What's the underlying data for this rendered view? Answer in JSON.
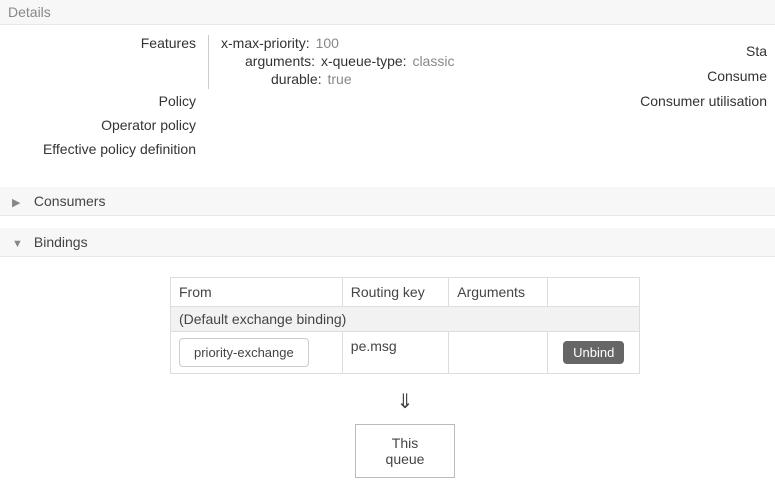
{
  "sections": {
    "details": {
      "title": "Details"
    },
    "consumers": {
      "title": "Consumers"
    },
    "bindings": {
      "title": "Bindings"
    }
  },
  "details": {
    "features_label": "Features",
    "features": {
      "x_max_priority_key": "x-max-priority:",
      "x_max_priority_val": "100",
      "arguments_key": "arguments:",
      "arguments_inner_key": "x-queue-type:",
      "arguments_inner_val": "classic",
      "durable_key": "durable:",
      "durable_val": "true"
    },
    "policy_label": "Policy",
    "operator_policy_label": "Operator policy",
    "effective_policy_label": "Effective policy definition"
  },
  "meta": {
    "state": "Sta",
    "consumers": "Consume",
    "consumer_utilisation": "Consumer utilisation"
  },
  "bindings_table": {
    "col_from": "From",
    "col_routing_key": "Routing key",
    "col_arguments": "Arguments",
    "default_row": "(Default exchange binding)",
    "row1_from": "priority-exchange",
    "row1_key": "pe.msg",
    "row1_args": "",
    "unbind_label": "Unbind"
  },
  "flow": {
    "arrow": "⇓",
    "this_queue": "This queue"
  }
}
